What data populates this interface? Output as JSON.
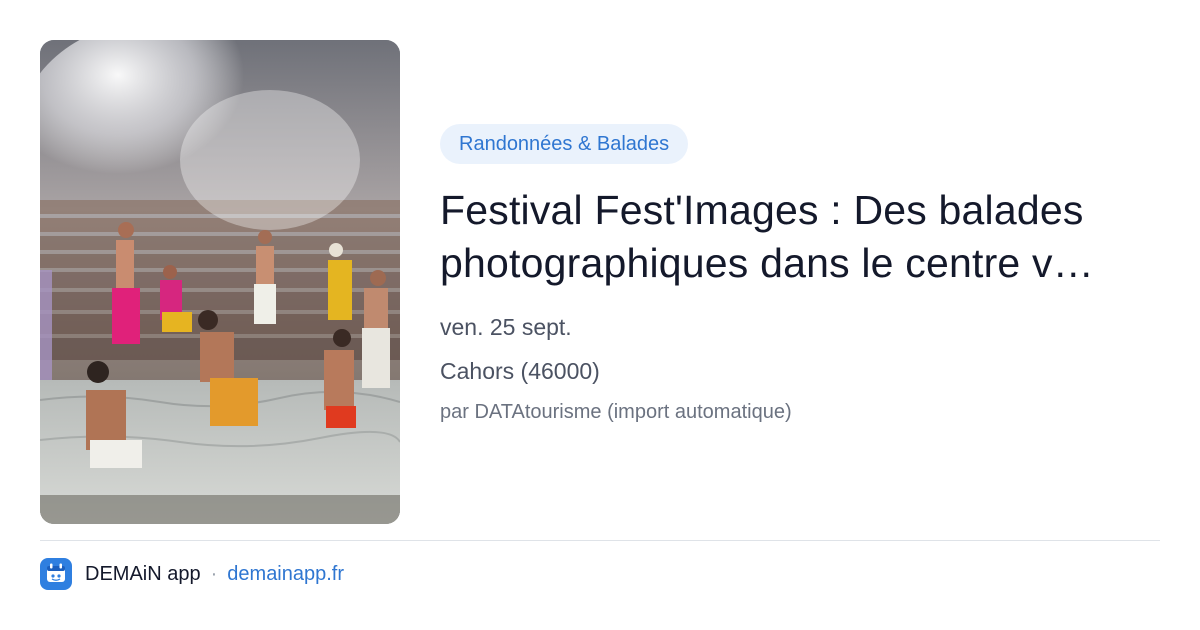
{
  "category": "Randonnées & Balades",
  "title_line1": "Festival Fest'Images : Des balades",
  "title_line2": "photographiques dans le centre v…",
  "date": "ven. 25 sept.",
  "location": "Cahors (46000)",
  "author": "par DATAtourisme (import automatique)",
  "footer": {
    "app_name": "DEMAiN app",
    "separator": "·",
    "site": "demainapp.fr"
  },
  "colors": {
    "accent": "#2f76d1",
    "tag_bg": "#eaf2fc",
    "title": "#14192b",
    "meta": "#4b5262"
  },
  "icons": {
    "app_icon": "demain-app-icon"
  }
}
